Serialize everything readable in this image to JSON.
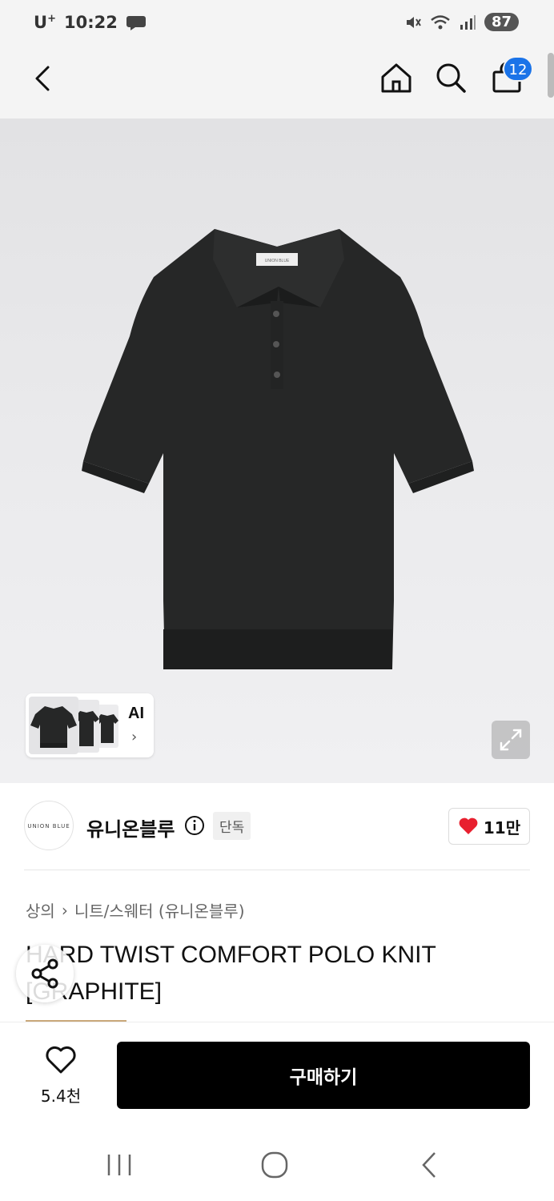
{
  "status_bar": {
    "carrier": "U",
    "carrier_sup": "+",
    "time": "10:22",
    "battery": "87"
  },
  "header": {
    "cart_badge": "12"
  },
  "gallery": {
    "ai_label": "AI",
    "ai_chevron": "›",
    "shirt_tag": "UNION BLUE"
  },
  "brand": {
    "logo_text": "UNION BLUE",
    "name": "유니온블루",
    "exclusive": "단독",
    "likes": "11만"
  },
  "product": {
    "breadcrumb": [
      "상의",
      "니트/스웨터 (유니온블루)"
    ],
    "breadcrumb_sep": "›",
    "title": "HARD TWIST COMFORT POLO KNIT [GRAPHITE]"
  },
  "bottom_bar": {
    "wish_count": "5.4천",
    "buy_label": "구매하기"
  },
  "colors": {
    "accent_blue": "#1a73e8",
    "heart_red": "#e8202f",
    "shirt": "#262727",
    "buy_button": "#000000"
  },
  "icons": [
    "back-icon",
    "home-icon",
    "search-icon",
    "cart-icon",
    "expand-icon",
    "info-icon",
    "heart-icon",
    "share-icon",
    "nav-recents-icon",
    "nav-home-icon",
    "nav-back-icon"
  ]
}
